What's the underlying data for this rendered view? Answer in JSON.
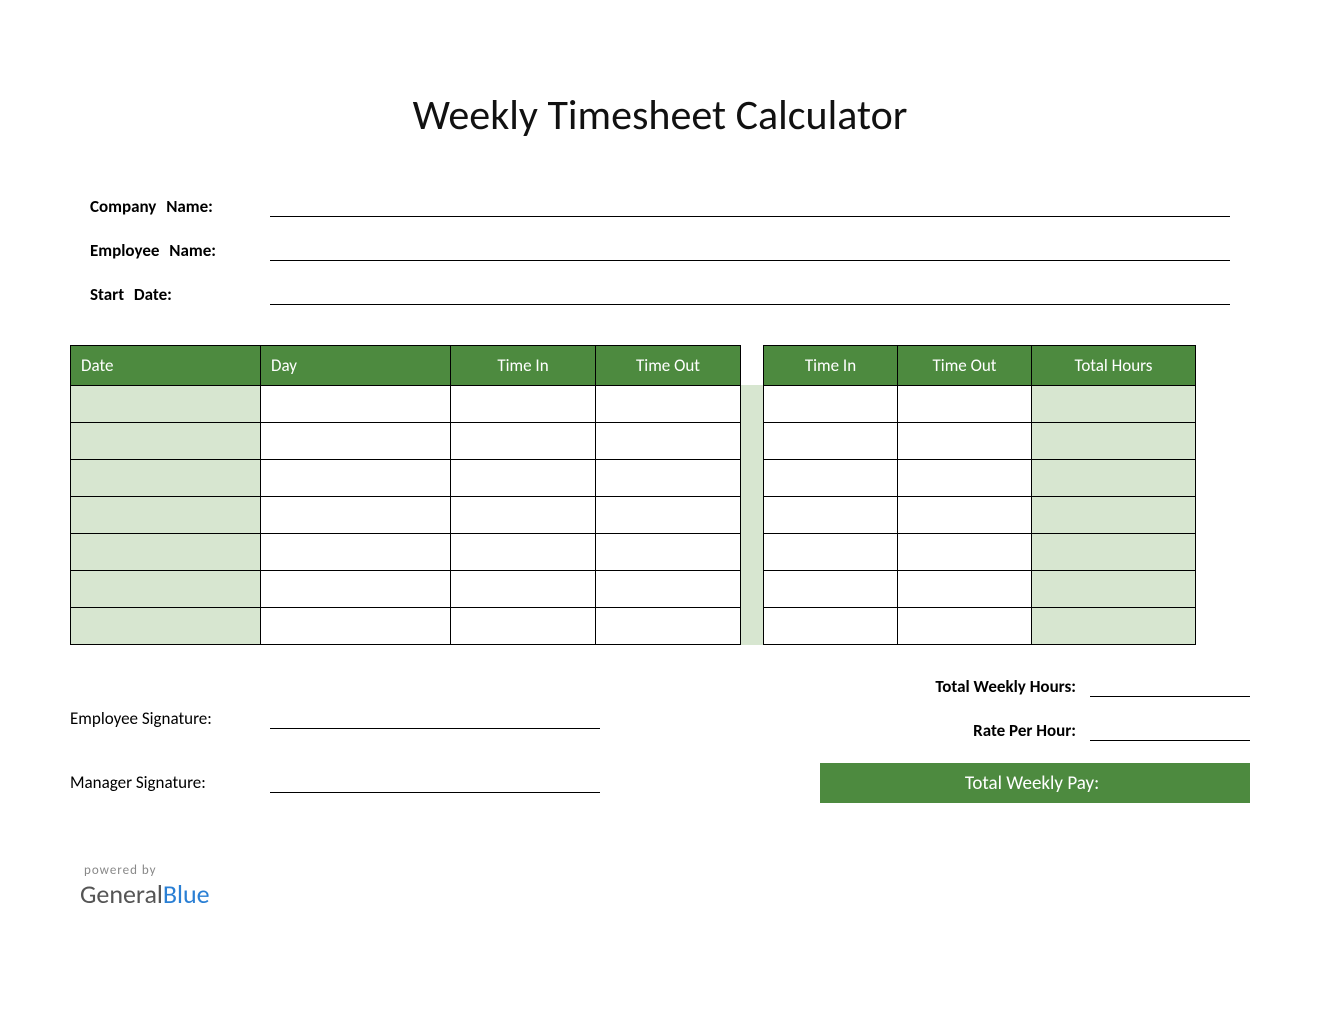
{
  "title": "Weekly Timesheet Calculator",
  "info": {
    "company_label": "Company  Name:",
    "employee_label": "Employee  Name:",
    "startdate_label": "Start Date:",
    "company_value": "",
    "employee_value": "",
    "startdate_value": ""
  },
  "table": {
    "left_headers": [
      "Date",
      "Day",
      "Time In",
      "Time Out"
    ],
    "right_headers": [
      "Time In",
      "Time Out",
      "Total Hours"
    ],
    "rows": [
      {
        "date": "",
        "day": "",
        "time_in_1": "",
        "time_out_1": "",
        "time_in_2": "",
        "time_out_2": "",
        "total": ""
      },
      {
        "date": "",
        "day": "",
        "time_in_1": "",
        "time_out_1": "",
        "time_in_2": "",
        "time_out_2": "",
        "total": ""
      },
      {
        "date": "",
        "day": "",
        "time_in_1": "",
        "time_out_1": "",
        "time_in_2": "",
        "time_out_2": "",
        "total": ""
      },
      {
        "date": "",
        "day": "",
        "time_in_1": "",
        "time_out_1": "",
        "time_in_2": "",
        "time_out_2": "",
        "total": ""
      },
      {
        "date": "",
        "day": "",
        "time_in_1": "",
        "time_out_1": "",
        "time_in_2": "",
        "time_out_2": "",
        "total": ""
      },
      {
        "date": "",
        "day": "",
        "time_in_1": "",
        "time_out_1": "",
        "time_in_2": "",
        "time_out_2": "",
        "total": ""
      },
      {
        "date": "",
        "day": "",
        "time_in_1": "",
        "time_out_1": "",
        "time_in_2": "",
        "time_out_2": "",
        "total": ""
      }
    ]
  },
  "signatures": {
    "employee_label": "Employee Signature:",
    "manager_label": "Manager Signature:"
  },
  "totals": {
    "hours_label": "Total Weekly Hours:",
    "rate_label": "Rate Per Hour:",
    "pay_label": "Total Weekly Pay:",
    "hours_value": "",
    "rate_value": "",
    "pay_value": ""
  },
  "brand": {
    "powered": "powered by",
    "part1": "General",
    "part2": "Blue"
  }
}
